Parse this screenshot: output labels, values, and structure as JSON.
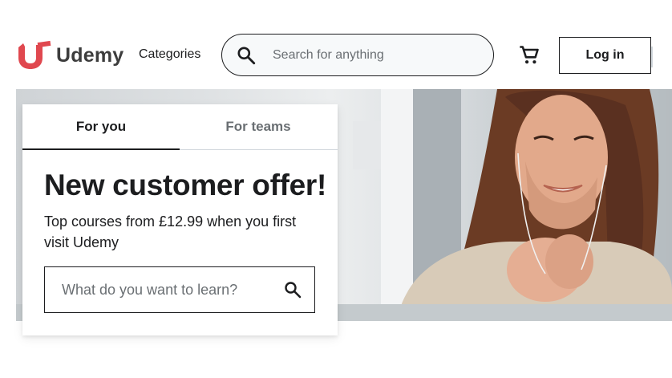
{
  "header": {
    "brand_name": "Udemy",
    "categories_label": "Categories",
    "search_placeholder": "Search for anything",
    "login_label": "Log in"
  },
  "card": {
    "tabs": [
      {
        "label": "For you",
        "active": true
      },
      {
        "label": "For teams",
        "active": false
      }
    ],
    "offer_title": "New customer offer!",
    "offer_subtitle": "Top courses from £12.99 when you first visit Udemy",
    "search_placeholder": "What do you want to learn?"
  },
  "colors": {
    "brand_red": "#e0484f",
    "text": "#1c1d1f",
    "muted": "#6a6f73"
  },
  "icons": [
    "udemy-logo",
    "search-icon",
    "cart-icon"
  ]
}
